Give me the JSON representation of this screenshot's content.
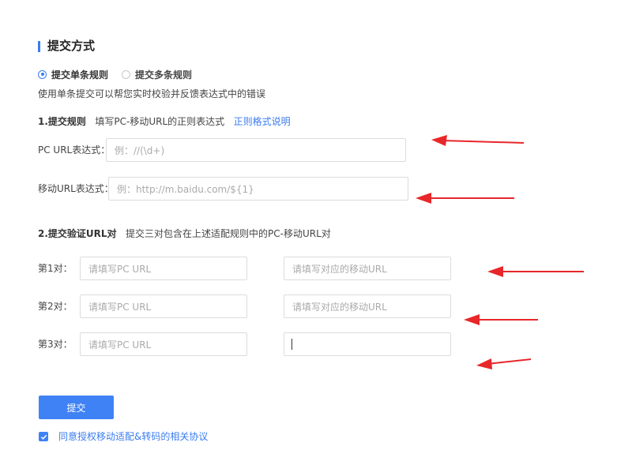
{
  "section": {
    "title": "提交方式"
  },
  "mode": {
    "options": [
      {
        "label": "提交单条规则",
        "selected": true
      },
      {
        "label": "提交多条规则",
        "selected": false
      }
    ],
    "description": "使用单条提交可以帮您实时校验并反馈表达式中的错误"
  },
  "rule": {
    "heading": "1.提交规则",
    "hint": "填写PC-移动URL的正则表达式",
    "link": "正则格式说明",
    "pc_label": "PC URL表达式：",
    "pc_placeholder": "例：//(\\d+)",
    "mobile_label": "移动URL表达式：",
    "mobile_placeholder": "例：http://m.baidu.com/${1}"
  },
  "verify": {
    "heading": "2.提交验证URL对",
    "hint": "提交三对包含在上述适配规则中的PC-移动URL对",
    "pairs": [
      {
        "label": "第1对：",
        "pc_placeholder": "请填写PC URL",
        "mobile_placeholder": "请填写对应的移动URL",
        "mobile_value": ""
      },
      {
        "label": "第2对：",
        "pc_placeholder": "请填写PC URL",
        "mobile_placeholder": "请填写对应的移动URL",
        "mobile_value": ""
      },
      {
        "label": "第3对：",
        "pc_placeholder": "请填写PC URL",
        "mobile_placeholder": "",
        "mobile_value": ""
      }
    ]
  },
  "submit": {
    "label": "提交"
  },
  "agreement": {
    "checked": true,
    "label": "同意授权移动适配&转码的相关协议"
  },
  "colors": {
    "accent": "#3a7cf0",
    "annotation_arrow": "#e8272a"
  },
  "icons": {
    "checkbox": "check-icon",
    "annotation": "red-arrow-icon"
  }
}
